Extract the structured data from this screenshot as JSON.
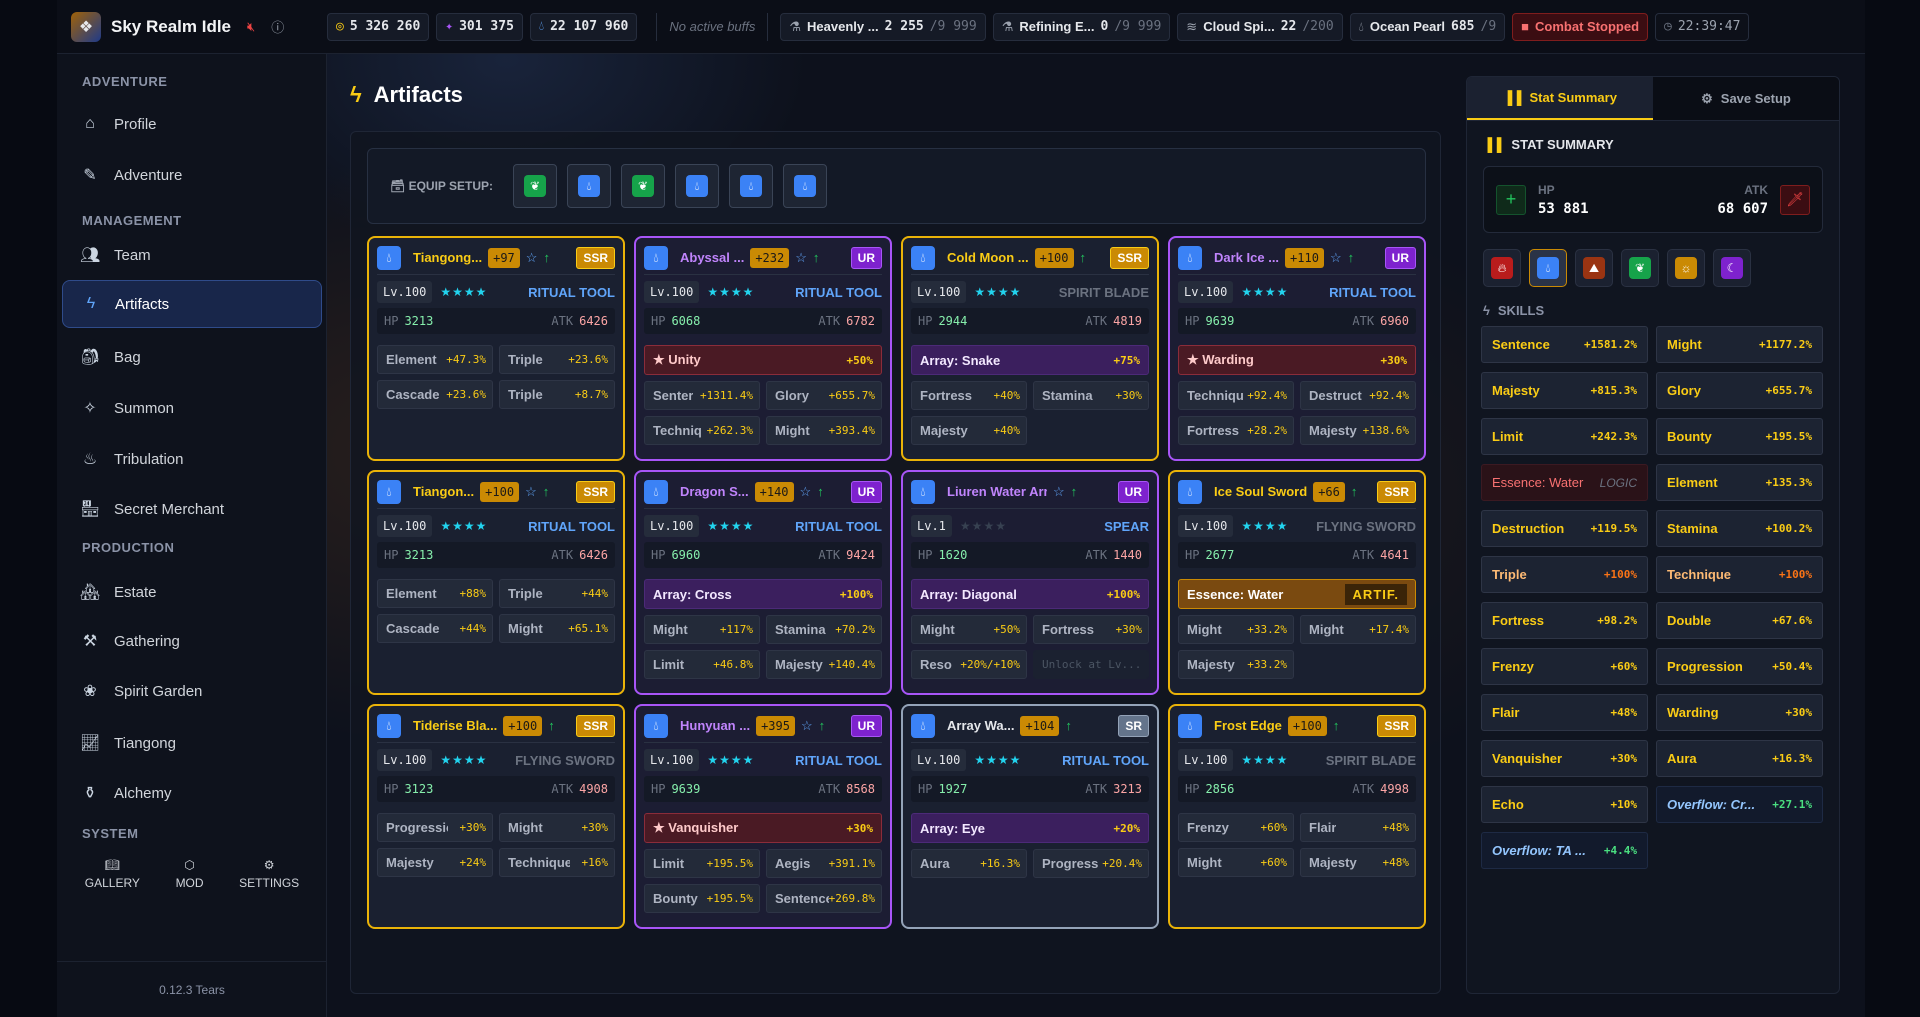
{
  "app": {
    "title": "Sky Realm Idle",
    "version": "0.12.3 Tears"
  },
  "topbar": {
    "gold": "5 326 260",
    "spirit": "301 375",
    "water": "22 107 960",
    "buffs": "No active buffs",
    "materials": [
      {
        "icon": "flask-icon",
        "name": "Heavenly ...",
        "have": "2 255",
        "max": "/9 999"
      },
      {
        "icon": "flask-icon",
        "name": "Refining E...",
        "have": "0",
        "max": "/9 999"
      },
      {
        "icon": "wind-icon",
        "name": "Cloud Spi...",
        "have": "22",
        "max": "/200"
      },
      {
        "icon": "drop-icon",
        "name": "Ocean Pearl",
        "have": "685",
        "max": "/9"
      }
    ],
    "combat": "Combat Stopped",
    "clock": "22:39:47"
  },
  "sidebar": {
    "sections": [
      "ADVENTURE",
      "MANAGEMENT",
      "PRODUCTION",
      "SYSTEM"
    ],
    "items": [
      "Profile",
      "Adventure",
      "Team",
      "Artifacts",
      "Bag",
      "Summon",
      "Tribulation",
      "Secret Merchant",
      "Estate",
      "Gathering",
      "Spirit Garden",
      "Tiangong",
      "Alchemy"
    ],
    "system": [
      "GALLERY",
      "MOD",
      "SETTINGS"
    ]
  },
  "main": {
    "title": "Artifacts",
    "equip_label": "EQUIP SETUP:",
    "equip_slots": [
      "water-wood",
      "water",
      "wood",
      "water",
      "water",
      "water"
    ]
  },
  "cards": [
    {
      "name": "Tiangong...",
      "plus": "+97",
      "fav": true,
      "rarity": "SSR",
      "lv": "Lv.100",
      "stars": 4,
      "type": "RITUAL TOOL",
      "grey": false,
      "hp": "3213",
      "atk": "6426",
      "affixes": [
        [
          "Element",
          "+47.3%"
        ],
        [
          "Triple",
          "+23.6%"
        ],
        [
          "Cascade",
          "+23.6%"
        ],
        [
          "Triple",
          "+8.7%"
        ]
      ]
    },
    {
      "name": "Abyssal ...",
      "plus": "+232",
      "fav": true,
      "rarity": "UR",
      "lv": "Lv.100",
      "stars": 4,
      "type": "RITUAL TOOL",
      "grey": false,
      "hp": "6068",
      "atk": "6782",
      "special": {
        "kind": "red",
        "label": "★ Unity",
        "value": "+50%"
      },
      "affixes": [
        [
          "Senter",
          "+1311.4%"
        ],
        [
          "Glory",
          "+655.7%"
        ],
        [
          "Techniq",
          "+262.3%"
        ],
        [
          "Might",
          "+393.4%"
        ]
      ]
    },
    {
      "name": "Cold Moon ...",
      "plus": "+100",
      "fav": false,
      "rarity": "SSR",
      "lv": "Lv.100",
      "stars": 4,
      "type": "SPIRIT BLADE",
      "grey": true,
      "hp": "2944",
      "atk": "4819",
      "special": {
        "kind": "purple",
        "label": "Array: Snake",
        "value": "+75%"
      },
      "affixes": [
        [
          "Fortress",
          "+40%"
        ],
        [
          "Stamina",
          "+30%"
        ],
        [
          "Majesty",
          "+40%"
        ]
      ]
    },
    {
      "name": "Dark Ice ...",
      "plus": "+110",
      "fav": true,
      "rarity": "UR",
      "lv": "Lv.100",
      "stars": 4,
      "type": "RITUAL TOOL",
      "grey": false,
      "hp": "9639",
      "atk": "6960",
      "special": {
        "kind": "red",
        "label": "★ Warding",
        "value": "+30%"
      },
      "affixes": [
        [
          "Techniqu",
          "+92.4%"
        ],
        [
          "Destruct",
          "+92.4%"
        ],
        [
          "Fortress",
          "+28.2%"
        ],
        [
          "Majesty",
          "+138.6%"
        ]
      ]
    },
    {
      "name": "Tiangon...",
      "plus": "+100",
      "fav": true,
      "rarity": "SSR",
      "lv": "Lv.100",
      "stars": 4,
      "type": "RITUAL TOOL",
      "grey": false,
      "hp": "3213",
      "atk": "6426",
      "affixes": [
        [
          "Element",
          "+88%"
        ],
        [
          "Triple",
          "+44%"
        ],
        [
          "Cascade",
          "+44%"
        ],
        [
          "Might",
          "+65.1%"
        ]
      ]
    },
    {
      "name": "Dragon S...",
      "plus": "+140",
      "fav": true,
      "rarity": "UR",
      "lv": "Lv.100",
      "stars": 4,
      "type": "RITUAL TOOL",
      "grey": false,
      "hp": "6960",
      "atk": "9424",
      "special": {
        "kind": "purple",
        "label": "Array: Cross",
        "value": "+100%"
      },
      "affixes": [
        [
          "Might",
          "+117%"
        ],
        [
          "Stamina",
          "+70.2%"
        ],
        [
          "Limit",
          "+46.8%"
        ],
        [
          "Majesty",
          "+140.4%"
        ]
      ]
    },
    {
      "name": "Liuren Water Arr...",
      "plus": "",
      "fav": true,
      "rarity": "UR",
      "lv": "Lv.1",
      "stars": 0,
      "type": "SPEAR",
      "grey": false,
      "hp": "1620",
      "atk": "1440",
      "special": {
        "kind": "purple",
        "label": "Array: Diagonal",
        "value": "+100%"
      },
      "affixes": [
        [
          "Might",
          "+50%"
        ],
        [
          "Fortress",
          "+30%"
        ],
        [
          "Reso",
          "+20%/+10%"
        ]
      ],
      "locked": "Unlock at Lv..."
    },
    {
      "name": "Ice Soul Sword",
      "plus": "+66",
      "fav": false,
      "rarity": "SSR",
      "lv": "Lv.100",
      "stars": 4,
      "type": "FLYING SWORD",
      "grey": true,
      "hp": "2677",
      "atk": "4641",
      "special": {
        "kind": "orange",
        "label": "Essence: Water",
        "tag": "ARTIF."
      },
      "affixes": [
        [
          "Might",
          "+33.2%"
        ],
        [
          "Might",
          "+17.4%"
        ],
        [
          "Majesty",
          "+33.2%"
        ]
      ]
    },
    {
      "name": "Tiderise Bla...",
      "plus": "+100",
      "fav": false,
      "rarity": "SSR",
      "lv": "Lv.100",
      "stars": 4,
      "type": "FLYING SWORD",
      "grey": true,
      "hp": "3123",
      "atk": "4908",
      "affixes": [
        [
          "Progression",
          "+30%"
        ],
        [
          "Might",
          "+30%"
        ],
        [
          "Majesty",
          "+24%"
        ],
        [
          "Technique",
          "+16%"
        ]
      ]
    },
    {
      "name": "Hunyuan ...",
      "plus": "+395",
      "fav": true,
      "rarity": "UR",
      "lv": "Lv.100",
      "stars": 4,
      "type": "RITUAL TOOL",
      "grey": false,
      "hp": "9639",
      "atk": "8568",
      "special": {
        "kind": "red",
        "label": "★ Vanquisher",
        "value": "+30%"
      },
      "affixes": [
        [
          "Limit",
          "+195.5%"
        ],
        [
          "Aegis",
          "+391.1%"
        ],
        [
          "Bounty",
          "+195.5%"
        ],
        [
          "Sentence",
          "+269.8%"
        ]
      ]
    },
    {
      "name": "Array Wa...",
      "plus": "+104",
      "fav": false,
      "rarity": "SR",
      "lv": "Lv.100",
      "stars": 4,
      "type": "RITUAL TOOL",
      "grey": false,
      "hp": "1927",
      "atk": "3213",
      "special": {
        "kind": "purple",
        "label": "Array: Eye",
        "value": "+20%"
      },
      "affixes": [
        [
          "Aura",
          "+16.3%"
        ],
        [
          "Progress",
          "+20.4%"
        ]
      ]
    },
    {
      "name": "Frost Edge",
      "plus": "+100",
      "fav": false,
      "rarity": "SSR",
      "lv": "Lv.100",
      "stars": 4,
      "type": "SPIRIT BLADE",
      "grey": true,
      "hp": "2856",
      "atk": "4998",
      "affixes": [
        [
          "Frenzy",
          "+60%"
        ],
        [
          "Flair",
          "+48%"
        ],
        [
          "Might",
          "+60%"
        ],
        [
          "Majesty",
          "+48%"
        ]
      ]
    }
  ],
  "right": {
    "tabs": [
      "Stat Summary",
      "Save Setup"
    ],
    "title": "STAT SUMMARY",
    "hp_label": "HP",
    "hp": "53 881",
    "atk_label": "ATK",
    "atk": "68 607",
    "elements": [
      "fire",
      "water",
      "earth",
      "wood",
      "metal",
      "dark"
    ],
    "selected_element": "water",
    "skills_label": "SKILLS",
    "skills": [
      {
        "n": "Sentence",
        "v": "+1581.2%"
      },
      {
        "n": "Might",
        "v": "+1177.2%"
      },
      {
        "n": "Majesty",
        "v": "+815.3%"
      },
      {
        "n": "Glory",
        "v": "+655.7%"
      },
      {
        "n": "Limit",
        "v": "+242.3%"
      },
      {
        "n": "Bounty",
        "v": "+195.5%"
      },
      {
        "n": "Essence: Water",
        "v": "LOGIC",
        "k": "logic"
      },
      {
        "n": "Element",
        "v": "+135.3%"
      },
      {
        "n": "Destruction",
        "v": "+119.5%"
      },
      {
        "n": "Stamina",
        "v": "+100.2%"
      },
      {
        "n": "Triple",
        "v": "+100%",
        "k": "orange"
      },
      {
        "n": "Technique",
        "v": "+100%",
        "k": "orange"
      },
      {
        "n": "Fortress",
        "v": "+98.2%"
      },
      {
        "n": "Double",
        "v": "+67.6%"
      },
      {
        "n": "Frenzy",
        "v": "+60%"
      },
      {
        "n": "Progression",
        "v": "+50.4%"
      },
      {
        "n": "Flair",
        "v": "+48%"
      },
      {
        "n": "Warding",
        "v": "+30%"
      },
      {
        "n": "Vanquisher",
        "v": "+30%"
      },
      {
        "n": "Aura",
        "v": "+16.3%"
      },
      {
        "n": "Echo",
        "v": "+10%"
      },
      {
        "n": "Overflow: Cr...",
        "v": "+27.1%",
        "k": "over"
      },
      {
        "n": "Overflow: TA ...",
        "v": "+4.4%",
        "k": "over"
      }
    ]
  }
}
